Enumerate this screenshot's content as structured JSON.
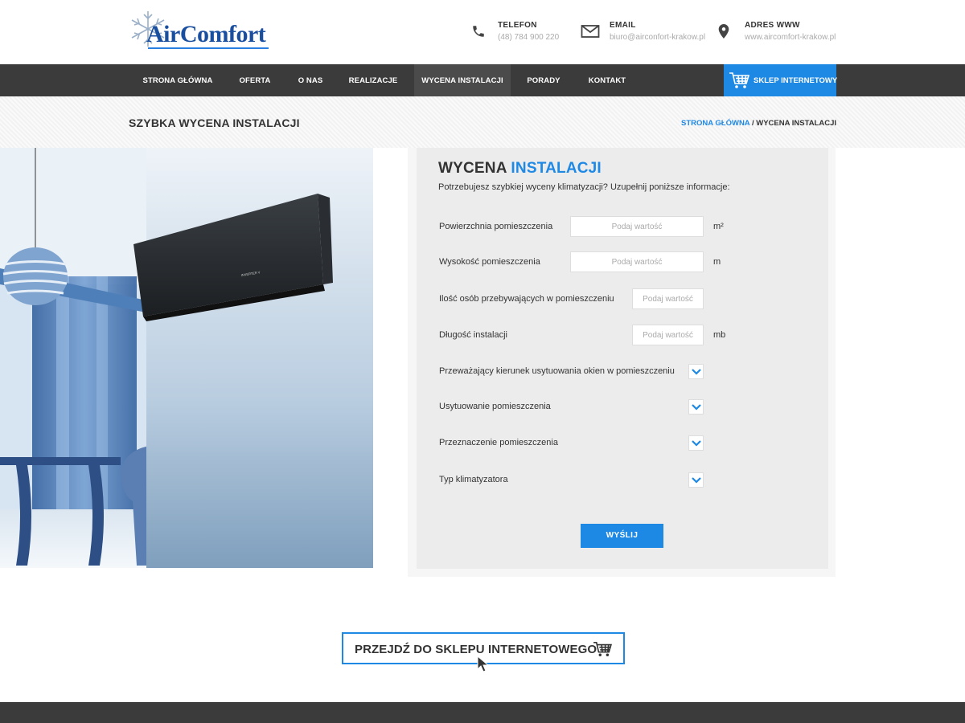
{
  "brand": {
    "logo_text": "AirComfort"
  },
  "header": {
    "contacts": [
      {
        "icon": "phone-icon",
        "label": "TELEFON",
        "value": "(48) 784 900 220"
      },
      {
        "icon": "envelope-icon",
        "label": "EMAIL",
        "value": "biuro@airconfort-krakow.pl"
      },
      {
        "icon": "map-pin-icon",
        "label": "ADRES WWW",
        "value": "www.aircomfort-krakow.pl"
      }
    ]
  },
  "nav": {
    "items": [
      {
        "label": "STRONA GŁÓWNA"
      },
      {
        "label": "OFERTA"
      },
      {
        "label": "O NAS"
      },
      {
        "label": "REALIZACJE"
      },
      {
        "label": "WYCENA INSTALACJI",
        "active": true
      },
      {
        "label": "PORADY"
      },
      {
        "label": "KONTAKT"
      }
    ],
    "shop_button": "SKLEP INTERNETOWY"
  },
  "page": {
    "title": "SZYBKA WYCENA INSTALACJI",
    "breadcrumb": {
      "home": "STRONA GŁÓWNA",
      "separator": " / ",
      "current": "WYCENA INSTALACJI"
    }
  },
  "form": {
    "title_main": "WYCENA ",
    "title_accent": "INSTALACJI",
    "subtitle": "Potrzebujesz szybkiej wyceny klimatyzacji? Uzupełnij poniższe informacje:",
    "placeholder": "Podaj wartość",
    "fields": [
      {
        "label": "Powierzchnia pomieszczenia",
        "unit": "m²"
      },
      {
        "label": "Wysokość pomieszczenia",
        "unit": "m"
      },
      {
        "label": "Ilość osób przebywających w pomieszczeniu",
        "unit": ""
      },
      {
        "label": "Długość instalacji",
        "unit": "mb"
      }
    ],
    "selects": [
      {
        "label": "Przeważający kierunek usytuowania okien w pomieszczeniu"
      },
      {
        "label": "Usytuowanie pomieszczenia"
      },
      {
        "label": "Przeznaczenie pomieszczenia"
      },
      {
        "label": "Typ klimatyzatora"
      }
    ],
    "submit": "WYŚLIJ"
  },
  "cta": {
    "label": "PRZEJDŹ DO SKLEPU INTERNETOWEGO",
    "icon": "cart-icon"
  },
  "colors": {
    "accent": "#1e88e5",
    "nav_bg": "#3b3b3b",
    "logo": "#1a4fa0"
  }
}
